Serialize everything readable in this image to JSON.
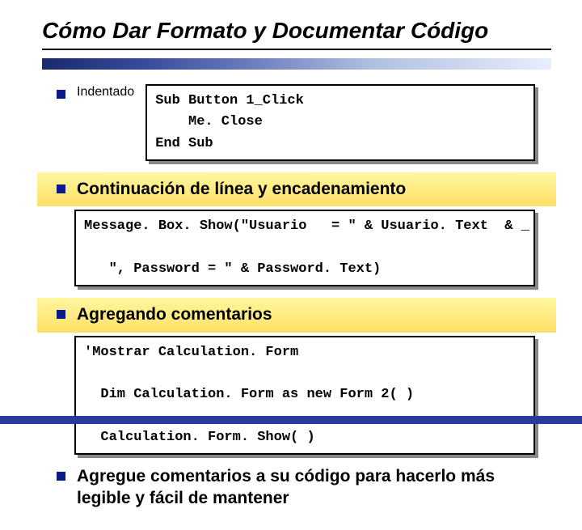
{
  "title": "Cómo Dar Formato y Documentar Código",
  "bullets": {
    "b1": "Indentado",
    "b2": "Continuación de línea y encadenamiento",
    "b3": "Agregando comentarios",
    "b4": "Agregue comentarios a su código para hacerlo más legible y fácil de mantener"
  },
  "code": {
    "box1": "Sub Button 1_Click\n    Me. Close\nEnd Sub",
    "box2": "Message. Box. Show(\"Usuario   = \" & Usuario. Text  & _\n\n   \", Password = \" & Password. Text)",
    "box3": "'Mostrar Calculation. Form\n\n  Dim Calculation. Form as new Form 2( )\n\n  Calculation. Form. Show( )"
  }
}
